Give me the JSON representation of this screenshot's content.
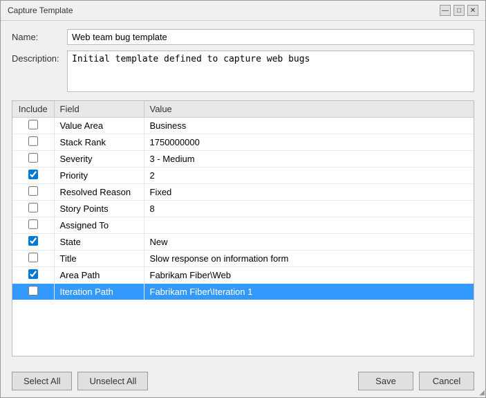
{
  "window": {
    "title": "Capture Template",
    "controls": {
      "minimize": "—",
      "maximize": "□",
      "close": "✕"
    }
  },
  "form": {
    "name_label": "Name:",
    "name_value": "Web team bug template",
    "description_label": "Description:",
    "description_value": "Initial template defined to capture web bugs"
  },
  "table": {
    "columns": [
      {
        "id": "include",
        "label": "Include"
      },
      {
        "id": "field",
        "label": "Field"
      },
      {
        "id": "value",
        "label": "Value"
      }
    ],
    "rows": [
      {
        "checked": false,
        "field": "Value Area",
        "value": "Business",
        "selected": false
      },
      {
        "checked": false,
        "field": "Stack Rank",
        "value": "1750000000",
        "selected": false
      },
      {
        "checked": false,
        "field": "Severity",
        "value": "3 - Medium",
        "selected": false
      },
      {
        "checked": true,
        "field": "Priority",
        "value": "2",
        "selected": false
      },
      {
        "checked": false,
        "field": "Resolved Reason",
        "value": "Fixed",
        "selected": false
      },
      {
        "checked": false,
        "field": "Story Points",
        "value": "8",
        "selected": false
      },
      {
        "checked": false,
        "field": "Assigned To",
        "value": "",
        "selected": false
      },
      {
        "checked": true,
        "field": "State",
        "value": "New",
        "selected": false
      },
      {
        "checked": false,
        "field": "Title",
        "value": "Slow response on information form",
        "selected": false
      },
      {
        "checked": true,
        "field": "Area Path",
        "value": "Fabrikam Fiber\\Web",
        "selected": false
      },
      {
        "checked": false,
        "field": "Iteration Path",
        "value": "Fabrikam Fiber\\Iteration 1",
        "selected": true
      }
    ]
  },
  "footer": {
    "select_all": "Select All",
    "unselect_all": "Unselect All",
    "save": "Save",
    "cancel": "Cancel"
  }
}
